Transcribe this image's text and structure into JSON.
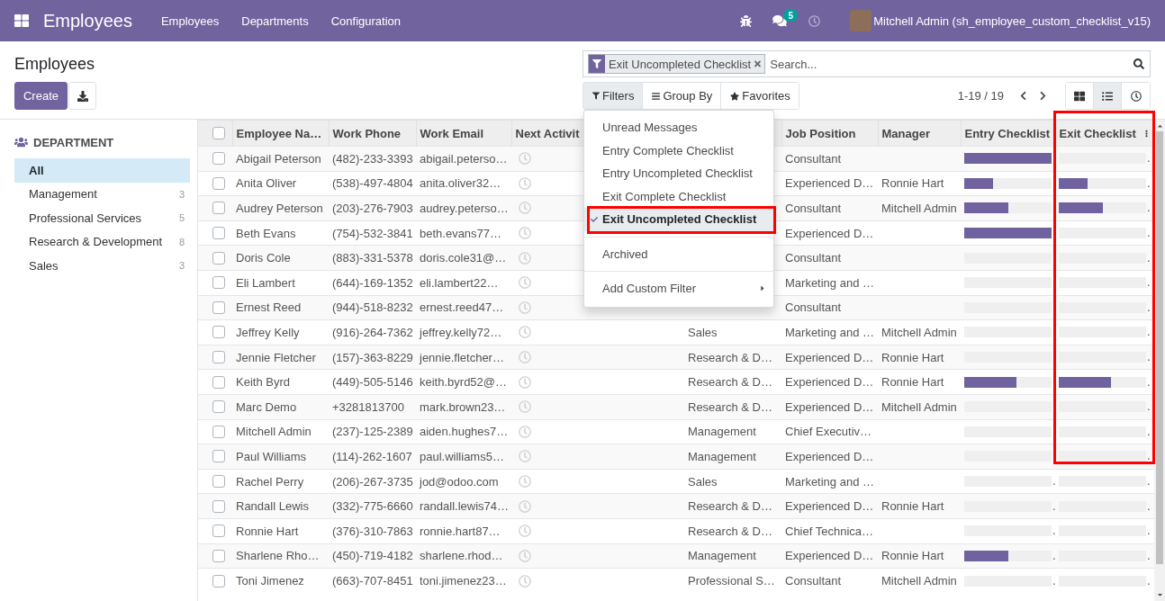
{
  "navbar": {
    "app_title": "Employees",
    "menu": [
      "Employees",
      "Departments",
      "Configuration"
    ],
    "chat_badge": "5",
    "user_name": "Mitchell Admin (sh_employee_custom_checklist_v15)"
  },
  "control_panel": {
    "title": "Employees",
    "create_button": "Create",
    "search": {
      "facets": [
        {
          "kind": "filter",
          "label": "Exit Uncompleted Checklist"
        }
      ],
      "placeholder": "Search..."
    },
    "filter_buttons": [
      {
        "kind": "filters",
        "label": "Filters",
        "expanded": true
      },
      {
        "kind": "group_by",
        "label": "Group By",
        "expanded": false
      },
      {
        "kind": "favorites",
        "label": "Favorites",
        "expanded": false
      }
    ],
    "pager": "1-19 / 19",
    "views": [
      {
        "kind": "kanban",
        "selected": false
      },
      {
        "kind": "list",
        "selected": true
      },
      {
        "kind": "activity",
        "selected": false
      }
    ]
  },
  "filter_menu": {
    "groups": [
      {
        "items": [
          {
            "kind": "option",
            "label": "Unread Messages",
            "selected": false,
            "highlighted": false
          },
          {
            "kind": "option",
            "label": "Entry Complete Checklist",
            "selected": false,
            "highlighted": false
          },
          {
            "kind": "option",
            "label": "Entry Uncompleted Checklist",
            "selected": false,
            "highlighted": false
          },
          {
            "kind": "option",
            "label": "Exit Complete Checklist",
            "selected": false,
            "highlighted": false
          },
          {
            "kind": "option",
            "label": "Exit Uncompleted Checklist",
            "selected": true,
            "highlighted": true
          }
        ]
      },
      {
        "items": [
          {
            "kind": "option",
            "label": "Archived",
            "selected": false,
            "highlighted": false
          }
        ]
      },
      {
        "items": [
          {
            "kind": "submenu",
            "label": "Add Custom Filter",
            "selected": false,
            "highlighted": false
          }
        ]
      }
    ]
  },
  "sidebar": {
    "title": "DEPARTMENT",
    "items": [
      {
        "label": "All",
        "selected": true
      },
      {
        "label": "Management",
        "count": "3",
        "selected": false
      },
      {
        "label": "Professional Services",
        "count": "5",
        "selected": false
      },
      {
        "label": "Research & Development",
        "count": "8",
        "selected": false
      },
      {
        "label": "Sales",
        "count": "3",
        "selected": false
      }
    ]
  },
  "table": {
    "select_all": {
      "checked": false
    },
    "columns": [
      {
        "kind": "text",
        "label": "Employee Na…",
        "highlighted": false
      },
      {
        "kind": "text",
        "label": "Work Phone",
        "highlighted": false
      },
      {
        "kind": "text",
        "label": "Work Email",
        "highlighted": false
      },
      {
        "kind": "activity",
        "label": "Next Activit",
        "highlighted": false
      },
      {
        "kind": "text"
      },
      {
        "kind": "text",
        "label": "Job Position",
        "highlighted": false
      },
      {
        "kind": "text",
        "label": "Manager",
        "highlighted": false
      },
      {
        "kind": "progress",
        "label": "Entry Checklist",
        "highlighted": false
      },
      {
        "kind": "progress",
        "label": "Exit Checklist",
        "highlighted": true
      }
    ],
    "rows": [
      {
        "checked": false,
        "cells": [
          "Abigail Peterson",
          "(482)-233-3393",
          "abigail.peterso…",
          null,
          null,
          "Consultant",
          null,
          {
            "level": 1
          },
          {
            "level": 0,
            "text": "."
          }
        ]
      },
      {
        "checked": false,
        "cells": [
          "Anita Oliver",
          "(538)-497-4804",
          "anita.oliver32…",
          null,
          null,
          "Experienced D…",
          "Ronnie Hart",
          {
            "level": 0.33
          },
          {
            "level": 0.33,
            "text": "."
          }
        ]
      },
      {
        "checked": false,
        "cells": [
          "Audrey Peterson",
          "(203)-276-7903",
          "audrey.peterso…",
          null,
          null,
          "Consultant",
          "Mitchell Admin",
          {
            "level": 0.5
          },
          {
            "level": 0.5,
            "text": "."
          }
        ]
      },
      {
        "checked": false,
        "cells": [
          "Beth Evans",
          "(754)-532-3841",
          "beth.evans77…",
          null,
          null,
          "Experienced D…",
          null,
          {
            "level": 1
          },
          {
            "level": 0,
            "text": "."
          }
        ]
      },
      {
        "checked": false,
        "cells": [
          "Doris Cole",
          "(883)-331-5378",
          "doris.cole31@…",
          null,
          null,
          "Consultant",
          null,
          {
            "level": 0
          },
          {
            "level": 0,
            "text": "."
          }
        ]
      },
      {
        "checked": false,
        "cells": [
          "Eli Lambert",
          "(644)-169-1352",
          "eli.lambert22…",
          null,
          null,
          "Marketing and …",
          null,
          {
            "level": 0
          },
          {
            "level": 0,
            "text": "."
          }
        ]
      },
      {
        "checked": false,
        "cells": [
          "Ernest Reed",
          "(944)-518-8232",
          "ernest.reed47…",
          null,
          null,
          "Consultant",
          null,
          {
            "level": 0
          },
          {
            "level": 0,
            "text": "."
          }
        ]
      },
      {
        "checked": false,
        "cells": [
          "Jeffrey Kelly",
          "(916)-264-7362",
          "jeffrey.kelly72…",
          null,
          "Sales",
          "Marketing and …",
          "Mitchell Admin",
          {
            "level": 0
          },
          {
            "level": 0,
            "text": "."
          }
        ]
      },
      {
        "checked": false,
        "cells": [
          "Jennie Fletcher",
          "(157)-363-8229",
          "jennie.fletcher…",
          null,
          "Research & D…",
          "Experienced D…",
          "Ronnie Hart",
          {
            "level": 0
          },
          {
            "level": 0,
            "text": "."
          }
        ]
      },
      {
        "checked": false,
        "cells": [
          "Keith Byrd",
          "(449)-505-5146",
          "keith.byrd52@…",
          null,
          "Research & D…",
          "Experienced D…",
          "Ronnie Hart",
          {
            "level": 0.6
          },
          {
            "level": 0.6,
            "text": "."
          }
        ]
      },
      {
        "checked": false,
        "cells": [
          "Marc Demo",
          "+3281813700",
          "mark.brown23…",
          null,
          "Research & D…",
          "Experienced D…",
          "Mitchell Admin",
          {
            "level": 0
          },
          {
            "level": 0,
            "text": "."
          }
        ]
      },
      {
        "checked": false,
        "cells": [
          "Mitchell Admin",
          "(237)-125-2389",
          "aiden.hughes7…",
          null,
          "Management",
          "Chief Executiv…",
          null,
          {
            "level": 0
          },
          {
            "level": 0,
            "text": "."
          }
        ]
      },
      {
        "checked": false,
        "cells": [
          "Paul Williams",
          "(114)-262-1607",
          "paul.williams5…",
          null,
          "Management",
          "Experienced D…",
          null,
          {
            "level": 0
          },
          {
            "level": 0,
            "text": "."
          }
        ]
      },
      {
        "checked": false,
        "cells": [
          "Rachel Perry",
          "(206)-267-3735",
          "jod@odoo.com",
          null,
          "Sales",
          "Marketing and …",
          null,
          {
            "level": 0,
            "text": "."
          },
          {
            "level": 0,
            "text": "."
          }
        ]
      },
      {
        "checked": false,
        "cells": [
          "Randall Lewis",
          "(332)-775-6660",
          "randall.lewis74…",
          null,
          "Research & D…",
          "Experienced D…",
          "Ronnie Hart",
          {
            "level": 0,
            "text": "."
          },
          {
            "level": 0,
            "text": "."
          }
        ]
      },
      {
        "checked": false,
        "cells": [
          "Ronnie Hart",
          "(376)-310-7863",
          "ronnie.hart87…",
          null,
          "Research & D…",
          "Chief Technica…",
          null,
          {
            "level": 0,
            "text": "."
          },
          {
            "level": 0,
            "text": "."
          }
        ]
      },
      {
        "checked": false,
        "cells": [
          "Sharlene Rho…",
          "(450)-719-4182",
          "sharlene.rhod…",
          null,
          "Management",
          "Experienced D…",
          "Ronnie Hart",
          {
            "level": 0.5,
            "text": "."
          },
          {
            "level": 0,
            "text": "."
          }
        ]
      },
      {
        "checked": false,
        "cells": [
          "Toni Jimenez",
          "(663)-707-8451",
          "toni.jimenez23…",
          null,
          "Professional S…",
          "Consultant",
          "Mitchell Admin",
          {
            "level": 0,
            "text": "."
          },
          {
            "level": 0,
            "text": "."
          }
        ]
      }
    ]
  }
}
